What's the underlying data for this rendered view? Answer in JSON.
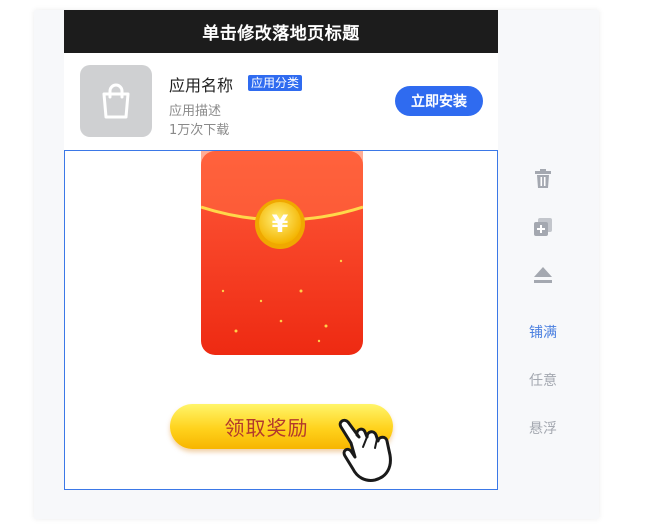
{
  "page": {
    "title": "单击修改落地页标题"
  },
  "app": {
    "name": "应用名称",
    "category_tag": "应用分类",
    "description": "应用描述",
    "downloads": "1万次下载",
    "install_label": "立即安装",
    "icon": "shopping-bag-icon"
  },
  "ad": {
    "envelope_icon": "red-envelope-icon",
    "coin_symbol": "¥",
    "claim_label": "领取奖励",
    "pointer_icon": "hand-pointer-icon"
  },
  "side_tools": {
    "delete_icon": "trash-icon",
    "copy_icon": "copy-add-icon",
    "top_icon": "move-to-top-icon",
    "fill_label": "铺满",
    "free_label": "任意",
    "float_label": "悬浮",
    "active": "铺满"
  },
  "colors": {
    "title_bar": "#1c1c1c",
    "accent": "#2f6bf0",
    "selection_border": "#3b78e7",
    "active_tool": "#4a7fe0",
    "inactive_tool": "#a4a8b0",
    "envelope_red": "#f23a1f",
    "button_gold": "#ffd21c"
  }
}
